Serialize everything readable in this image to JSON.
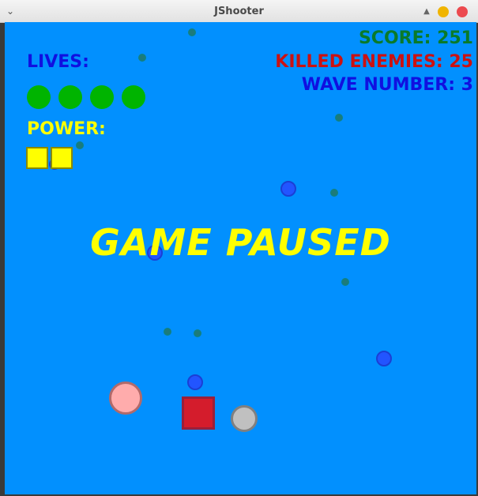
{
  "window": {
    "title": "JShooter"
  },
  "hud": {
    "score": "SCORE: 251",
    "killed_enemies": "KILLED ENEMIES: 25",
    "wave_number": "WAVE NUMBER: 3",
    "lives_label": "LIVES:",
    "power_label": "POWER:"
  },
  "lives": {
    "count": 4,
    "color": "#00b400"
  },
  "power": {
    "cells": 2,
    "color": "#ffff00"
  },
  "status": {
    "message": "GAME PAUSED"
  },
  "colors": {
    "background": "#0290fe",
    "score": "#0a7a2a",
    "killed": "#cc1111",
    "wave": "#1010e0",
    "paused": "#ffff00"
  }
}
